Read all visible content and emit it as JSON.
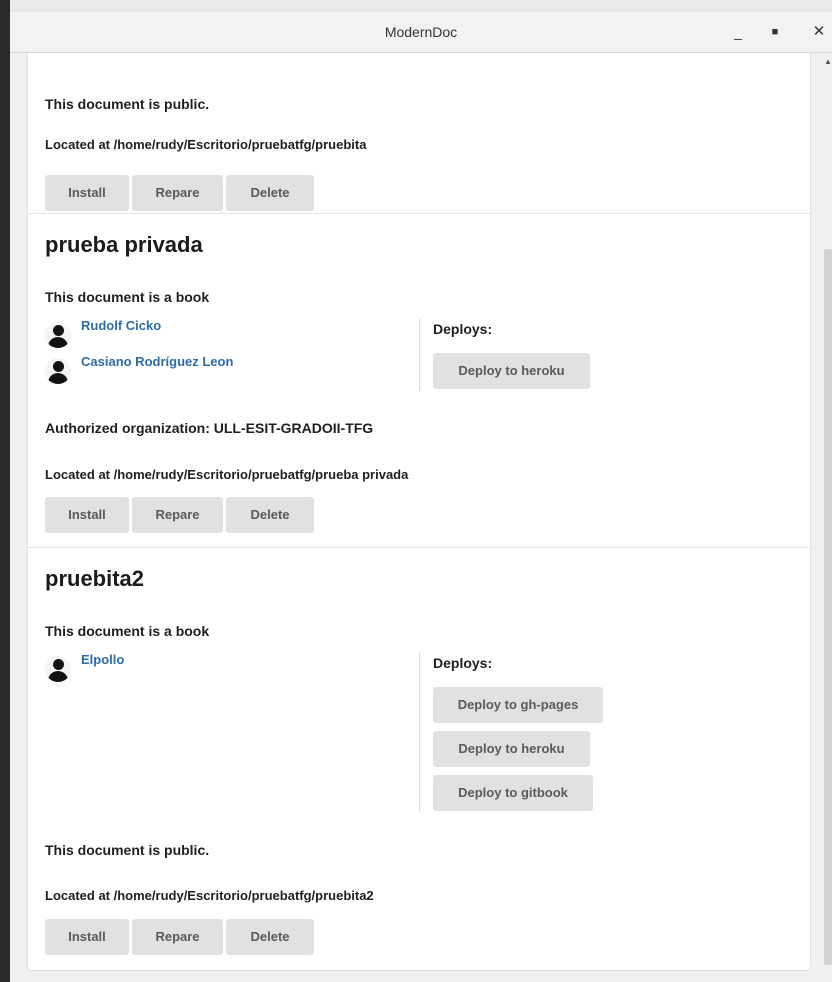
{
  "window": {
    "title": "ModernDoc",
    "minimize_glyph": "_",
    "maximize_glyph": "■",
    "close_glyph": "✕"
  },
  "actions": {
    "install": "Install",
    "repare": "Repare",
    "delete": "Delete"
  },
  "labels": {
    "deploys": "Deploys:"
  },
  "documents": [
    {
      "visibility": "This document is public.",
      "location": "Located at /home/rudy/Escritorio/pruebatfg/pruebita"
    },
    {
      "title": "prueba privada",
      "kind": "This document is a book",
      "authors": [
        "Rudolf Cicko",
        "Casiano Rodríguez Leon"
      ],
      "deploys": [
        "Deploy to heroku"
      ],
      "organization": "Authorized organization: ULL-ESIT-GRADOII-TFG",
      "location": "Located at /home/rudy/Escritorio/pruebatfg/prueba privada"
    },
    {
      "title": "pruebita2",
      "kind": "This document is a book",
      "authors": [
        "Elpollo"
      ],
      "deploys": [
        "Deploy to gh-pages",
        "Deploy to heroku",
        "Deploy to gitbook"
      ],
      "visibility": "This document is public.",
      "location": "Located at /home/rudy/Escritorio/pruebatfg/pruebita2"
    }
  ],
  "colors": {
    "link": "#2e6da4",
    "button_bg": "#e0e1e2",
    "button_text": "#5a5a5a"
  }
}
